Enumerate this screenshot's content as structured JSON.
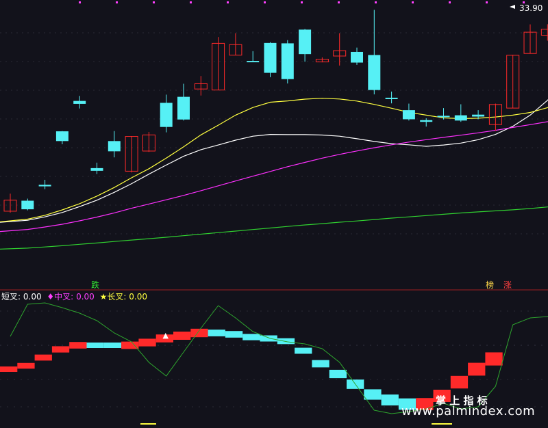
{
  "colors": {
    "background": "#12121b",
    "up": "#ff2a2a",
    "down": "#56f0f5",
    "ma5": "#ffffff",
    "ma10": "#ffff40",
    "ma20": "#ff30ff",
    "ma60": "#30d030",
    "grid": "#8a1f1f"
  },
  "price_label": "33.90",
  "signals": {
    "fall": "跌",
    "board": "榜",
    "rise": "涨"
  },
  "indicator": {
    "short_label": "短叉:",
    "short_value": "0.00",
    "mid_label": "♦中叉:",
    "mid_value": "0.00",
    "long_label": "★长叉:",
    "long_value": "0.00"
  },
  "watermark": {
    "cn": "掌 上 指 标",
    "url": "www.palmindex.com"
  },
  "chart_data": [
    {
      "type": "candlestick",
      "title": "",
      "y_top_label": "33.90",
      "candles": [
        {
          "o": 17.75,
          "c": 18.61,
          "h": 19.12,
          "l": 17.64,
          "dir": "up"
        },
        {
          "o": 18.57,
          "c": 17.9,
          "h": 18.73,
          "l": 17.82,
          "dir": "down"
        },
        {
          "o": 19.81,
          "c": 19.69,
          "h": 20.2,
          "l": 19.47,
          "dir": "down"
        },
        {
          "o": 23.98,
          "c": 23.22,
          "h": 24.0,
          "l": 22.97,
          "dir": "down"
        },
        {
          "o": 26.35,
          "c": 26.12,
          "h": 26.74,
          "l": 25.76,
          "dir": "down"
        },
        {
          "o": 20.9,
          "c": 21.11,
          "h": 21.54,
          "l": 20.65,
          "dir": "down"
        },
        {
          "o": 23.22,
          "c": 22.42,
          "h": 24.0,
          "l": 21.95,
          "dir": "down"
        },
        {
          "o": 20.87,
          "c": 23.58,
          "h": 23.61,
          "l": 20.77,
          "dir": "up"
        },
        {
          "o": 22.44,
          "c": 23.7,
          "h": 23.93,
          "l": 22.37,
          "dir": "up"
        },
        {
          "o": 26.2,
          "c": 24.32,
          "h": 26.84,
          "l": 23.9,
          "dir": "down"
        },
        {
          "o": 26.67,
          "c": 24.9,
          "h": 27.69,
          "l": 24.82,
          "dir": "down"
        },
        {
          "o": 27.28,
          "c": 27.69,
          "h": 28.29,
          "l": 26.77,
          "dir": "up"
        },
        {
          "o": 27.2,
          "c": 30.84,
          "h": 31.33,
          "l": 27.2,
          "dir": "up"
        },
        {
          "o": 29.92,
          "c": 30.74,
          "h": 31.63,
          "l": 29.92,
          "dir": "up"
        },
        {
          "o": 29.47,
          "c": 29.41,
          "h": 30.23,
          "l": 29.45,
          "dir": "down"
        },
        {
          "o": 30.87,
          "c": 28.54,
          "h": 30.93,
          "l": 28.2,
          "dir": "down"
        },
        {
          "o": 30.84,
          "c": 28.05,
          "h": 31.09,
          "l": 27.71,
          "dit": "down",
          "dir": "down"
        },
        {
          "o": 31.91,
          "c": 30.0,
          "h": 31.96,
          "l": 29.41,
          "dir": "down"
        },
        {
          "o": 29.39,
          "c": 29.6,
          "h": 29.74,
          "l": 29.36,
          "dir": "up"
        },
        {
          "o": 29.85,
          "c": 30.27,
          "h": 31.63,
          "l": 29.11,
          "dir": "up"
        },
        {
          "o": 30.17,
          "c": 29.34,
          "h": 30.51,
          "l": 29.16,
          "dir": "down"
        },
        {
          "o": 29.93,
          "c": 27.2,
          "h": 33.45,
          "l": 26.86,
          "dir": "down"
        },
        {
          "o": 26.6,
          "c": 26.54,
          "h": 27.08,
          "l": 26.16,
          "dir": "down"
        },
        {
          "o": 25.63,
          "c": 24.92,
          "h": 26.14,
          "l": 24.82,
          "dir": "down"
        },
        {
          "o": 24.85,
          "c": 24.72,
          "h": 25.0,
          "l": 24.35,
          "dir": "down"
        },
        {
          "o": 25.19,
          "c": 25.13,
          "h": 25.79,
          "l": 24.9,
          "dir": "down"
        },
        {
          "o": 25.23,
          "c": 24.82,
          "h": 26.09,
          "l": 24.72,
          "dir": "down"
        },
        {
          "o": 25.28,
          "c": 25.13,
          "h": 25.63,
          "l": 24.92,
          "dir": "down"
        },
        {
          "o": 24.51,
          "c": 26.07,
          "h": 26.14,
          "l": 24.01,
          "dir": "up"
        },
        {
          "o": 25.79,
          "c": 29.91,
          "h": 29.94,
          "l": 25.79,
          "dir": "up"
        },
        {
          "o": 30.05,
          "c": 31.71,
          "h": 32.32,
          "l": 30.05,
          "dir": "up"
        },
        {
          "o": 31.47,
          "c": 31.94,
          "h": 32.33,
          "l": 31.05,
          "dir": "up"
        },
        {
          "o": 32.09,
          "c": 33.26,
          "h": 33.64,
          "l": 32.06,
          "dir": "up"
        },
        {
          "o": 33.47,
          "c": 33.82,
          "h": 33.9,
          "l": 33.45,
          "dir": "up"
        }
      ],
      "series": [
        {
          "values": [
            16.88,
            17.04,
            17.31,
            17.65,
            18.11,
            18.61,
            19.22,
            19.9,
            20.64,
            21.35,
            22.03,
            22.55,
            22.91,
            23.29,
            23.6,
            23.74,
            23.72,
            23.72,
            23.69,
            23.6,
            23.4,
            23.19,
            23.02,
            22.93,
            22.81,
            22.91,
            23.06,
            23.33,
            23.74,
            24.37,
            25.24,
            26.4,
            27.87,
            29.41
          ]
        },
        {
          "values": [
            16.92,
            17.13,
            17.43,
            17.85,
            18.34,
            18.93,
            19.6,
            20.36,
            21.06,
            21.89,
            22.77,
            23.7,
            24.46,
            25.24,
            25.84,
            26.25,
            26.35,
            26.49,
            26.56,
            26.5,
            26.34,
            26.08,
            25.78,
            25.46,
            25.24,
            25.03,
            24.97,
            25.0,
            25.1,
            25.24,
            25.45,
            25.83,
            26.64,
            27.83
          ]
        },
        {
          "values": [
            16.17,
            16.33,
            16.52,
            16.73,
            17.0,
            17.29,
            17.62,
            17.98,
            18.31,
            18.64,
            18.98,
            19.35,
            19.73,
            20.11,
            20.48,
            20.85,
            21.22,
            21.56,
            21.89,
            22.18,
            22.45,
            22.7,
            22.93,
            23.14,
            23.33,
            23.51,
            23.68,
            23.86,
            24.06,
            24.28,
            24.5,
            24.73,
            25.03,
            25.42
          ]
        },
        {
          "values": [
            14.79,
            14.87,
            14.96,
            15.06,
            15.17,
            15.27,
            15.39,
            15.5,
            15.61,
            15.72,
            15.84,
            15.96,
            16.08,
            16.2,
            16.32,
            16.44,
            16.56,
            16.68,
            16.78,
            16.89,
            16.99,
            17.1,
            17.21,
            17.31,
            17.41,
            17.51,
            17.61,
            17.7,
            17.78,
            17.86,
            17.96,
            18.08,
            18.22,
            18.38
          ]
        }
      ],
      "markers": [
        {
          "index": 5,
          "label": "跌"
        },
        {
          "index": 28,
          "label": "榜"
        },
        {
          "index": 29,
          "label": "涨"
        }
      ]
    },
    {
      "type": "step",
      "title": "",
      "ylim": [
        -1,
        1
      ],
      "steps": [
        {
          "v": -0.35,
          "dir": "up"
        },
        {
          "v": -0.3,
          "dir": "up"
        },
        {
          "v": -0.18,
          "dir": "up"
        },
        {
          "v": -0.06,
          "dir": "up"
        },
        {
          "v": 0.0,
          "dir": "up"
        },
        {
          "v": 0.0,
          "dir": "down"
        },
        {
          "v": 0.0,
          "dir": "down"
        },
        {
          "v": 0.0,
          "dir": "up"
        },
        {
          "v": 0.04,
          "dir": "up"
        },
        {
          "v": 0.1,
          "dir": "up"
        },
        {
          "v": 0.14,
          "dir": "up"
        },
        {
          "v": 0.18,
          "dir": "up"
        },
        {
          "v": 0.18,
          "dir": "down"
        },
        {
          "v": 0.16,
          "dir": "down"
        },
        {
          "v": 0.12,
          "dir": "down"
        },
        {
          "v": 0.1,
          "dir": "down"
        },
        {
          "v": 0.06,
          "dir": "down"
        },
        {
          "v": -0.08,
          "dir": "down"
        },
        {
          "v": -0.27,
          "dir": "down"
        },
        {
          "v": -0.42,
          "dir": "down"
        },
        {
          "v": -0.57,
          "dir": "down"
        },
        {
          "v": -0.72,
          "dir": "down"
        },
        {
          "v": -0.8,
          "dir": "down"
        },
        {
          "v": -0.86,
          "dir": "down"
        },
        {
          "v": -0.86,
          "dir": "up"
        },
        {
          "v": -0.74,
          "dir": "up"
        },
        {
          "v": -0.54,
          "dir": "up"
        },
        {
          "v": -0.35,
          "dir": "up"
        },
        {
          "v": -0.2,
          "dir": "up"
        }
      ],
      "line": [
        0.13,
        0.6,
        0.62,
        0.55,
        0.47,
        0.36,
        0.18,
        0.05,
        -0.25,
        -0.45,
        -0.1,
        0.25,
        0.58,
        0.4,
        0.2,
        0.1,
        0.05,
        0.02,
        -0.05,
        -0.25,
        -0.6,
        -0.95,
        -1.0,
        -0.97,
        -0.93,
        -0.85,
        -0.93,
        -0.9,
        -0.6,
        0.3,
        0.4,
        0.42,
        0.53
      ],
      "markers": [
        {
          "index": 9,
          "label": "▲"
        }
      ]
    }
  ]
}
